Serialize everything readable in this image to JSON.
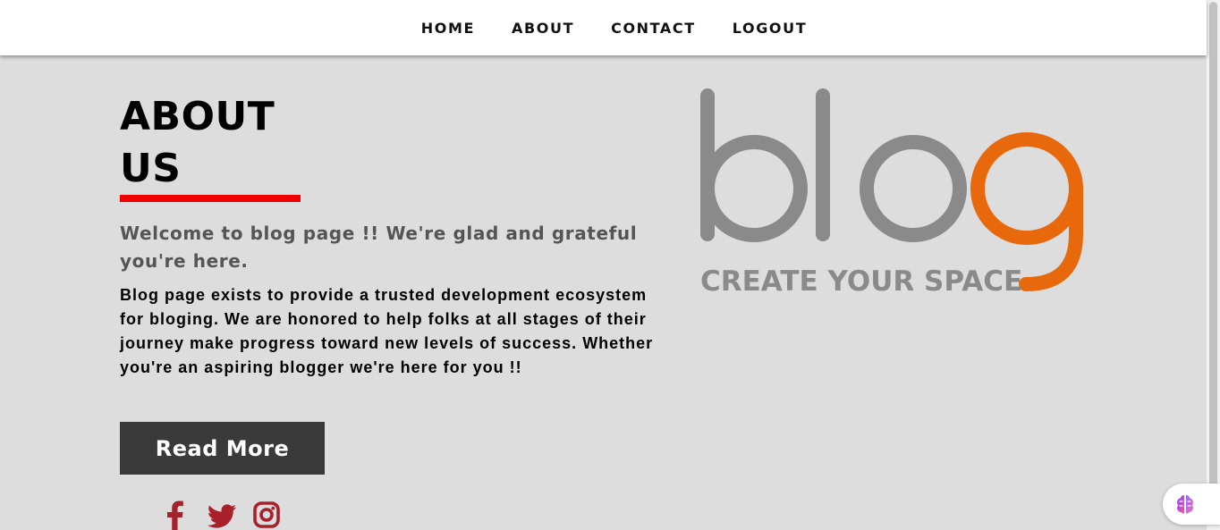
{
  "nav": {
    "items": [
      {
        "label": "HOME"
      },
      {
        "label": "ABOUT"
      },
      {
        "label": "CONTACT"
      },
      {
        "label": "LOGOUT"
      }
    ]
  },
  "about": {
    "title_line1": "ABOUT",
    "title_line2": "US",
    "subtitle": "Welcome to blog page !! We're glad and grateful you're here.",
    "body": "Blog page exists to provide a trusted development ecosystem for bloging. We are honored to help folks at all stages of their journey make progress toward new levels of success. Whether you're an aspiring blogger we're here for you !!",
    "read_more_label": "Read More"
  },
  "logo": {
    "tagline": "CREATE YOUR SPACE",
    "gray_color": "#8a8a8a",
    "orange_color": "#e8680c"
  },
  "socials": [
    {
      "icon": "facebook-icon"
    },
    {
      "icon": "twitter-icon"
    },
    {
      "icon": "instagram-icon"
    }
  ],
  "colors": {
    "accent_red": "#f00000",
    "social_red": "#a8202a",
    "button_bg": "#3a3a3a",
    "page_bg": "#dddddd"
  }
}
